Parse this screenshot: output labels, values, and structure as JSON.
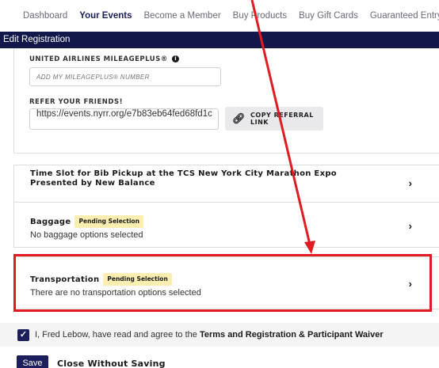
{
  "nav": {
    "items": [
      "Dashboard",
      "Your Events",
      "Become a Member",
      "Buy Products",
      "Buy Gift Cards",
      "Guaranteed Entry & Rewards"
    ],
    "active_index": 1
  },
  "edit_bar": {
    "title": "Edit Registration"
  },
  "mileageplus": {
    "label": "UNITED AIRLINES MILEAGEPLUS®",
    "info_icon": "info-icon",
    "placeholder": "ADD MY MILEAGEPLUS® NUMBER"
  },
  "referral": {
    "label": "REFER YOUR FRIENDS!",
    "value": "https://events.nyrr.org/e7b83eb64fed68fd1c",
    "copy_label": "COPY REFERRAL LINK"
  },
  "sections": {
    "timeslot": {
      "title": "Time Slot for Bib Pickup at the TCS New York City Marathon Expo Presented by New Balance"
    },
    "baggage": {
      "title": "Baggage",
      "badge": "Pending Selection",
      "subtitle": "No baggage options selected"
    },
    "transportation": {
      "title": "Transportation",
      "badge": "Pending Selection",
      "subtitle": "There are no transportation options selected"
    }
  },
  "agreement": {
    "prefix": "I, Fred Lebow, have read and agree to the ",
    "link": "Terms and Registration & Participant Waiver",
    "checked": true
  },
  "actions": {
    "save": "Save",
    "close": "Close Without Saving"
  },
  "colors": {
    "navy": "#12194a",
    "badge": "#fbeeb0",
    "highlight": "#e01b22"
  }
}
